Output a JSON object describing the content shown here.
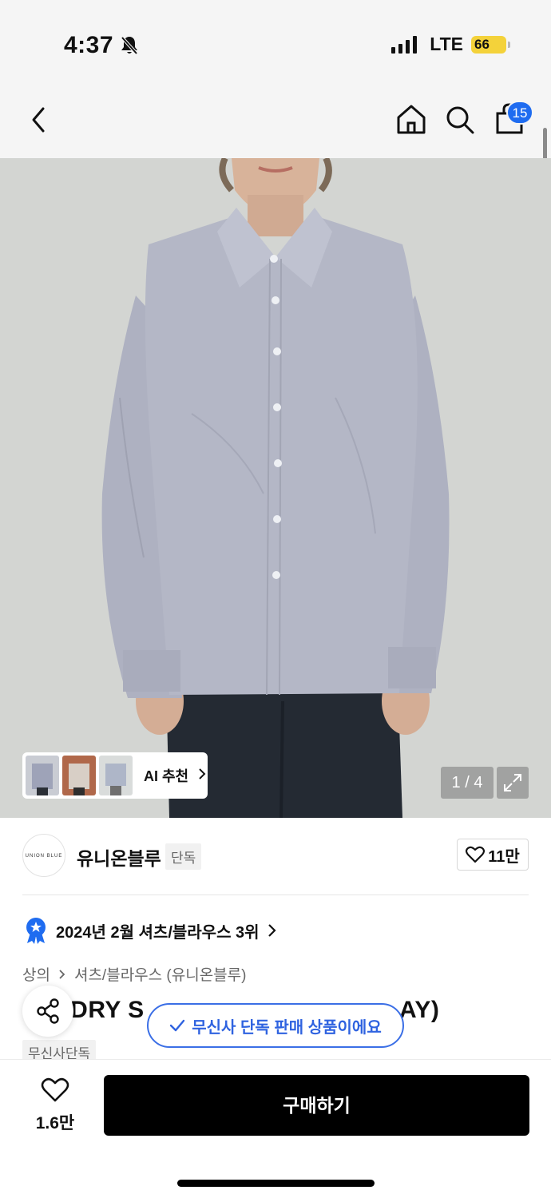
{
  "status": {
    "time": "4:37",
    "network": "LTE",
    "battery": "66"
  },
  "nav": {
    "cart_count": "15"
  },
  "hero": {
    "counter": "1 / 4",
    "ai_label": "AI 추천",
    "colors": {
      "background": "#d3d5d2",
      "shirt": "#b4b7c6",
      "jeans": "#242a33"
    }
  },
  "brand": {
    "logo_text": "UNION BLUE",
    "name": "유니온블루",
    "tag": "단독",
    "likes": "11만"
  },
  "rank": {
    "text": "2024년 2월 셔츠/블라우스 3위"
  },
  "breadcrumb": {
    "level1": "상의",
    "level2": "셔츠/블라우스 (유니온블루)"
  },
  "product": {
    "title_visible": "NDRY S",
    "title_end": "AY)",
    "exclusive_tag": "무신사단독"
  },
  "toast": {
    "text": "무신사 단독 판매 상품이에요"
  },
  "bottom": {
    "wish_count": "1.6만",
    "buy_label": "구매하기"
  },
  "accent": {
    "primary": "#1f6cf0",
    "buy_button": "#000000"
  }
}
